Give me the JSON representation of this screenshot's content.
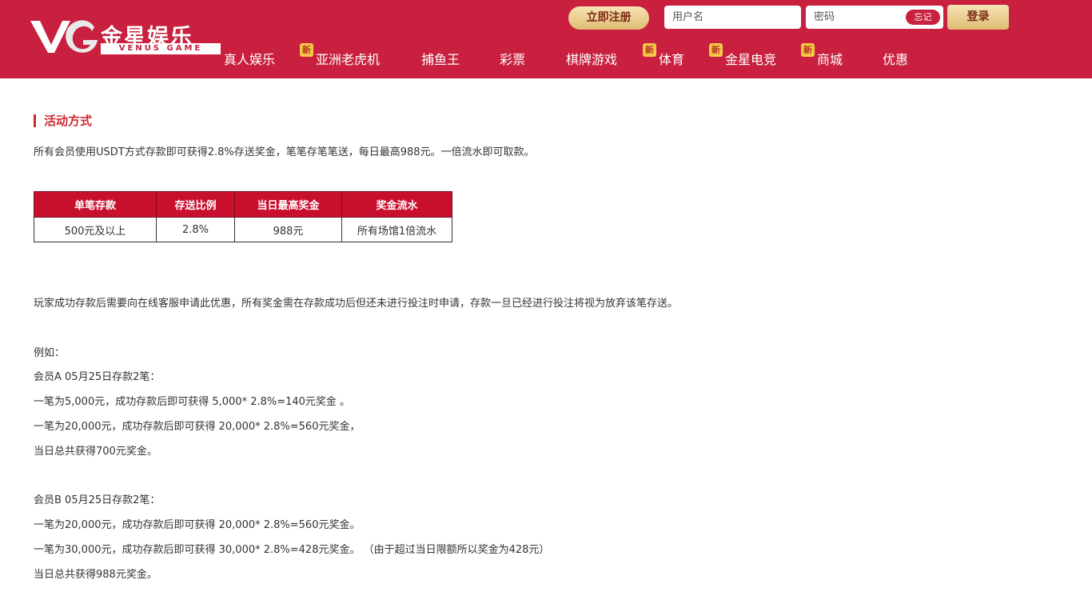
{
  "header": {
    "brand_cn": "金星娱乐",
    "brand_en": "VENUS GAME",
    "register_label": "立即注册",
    "username_placeholder": "用户名",
    "password_placeholder": "密码",
    "forgot_label": "忘记",
    "login_label": "登录"
  },
  "nav": [
    {
      "label": "真人娱乐",
      "badge": ""
    },
    {
      "label": "亚洲老虎机",
      "badge": "新"
    },
    {
      "label": "捕鱼王",
      "badge": ""
    },
    {
      "label": "彩票",
      "badge": ""
    },
    {
      "label": "棋牌游戏",
      "badge": ""
    },
    {
      "label": "体育",
      "badge": "新"
    },
    {
      "label": "金星电竞",
      "badge": "新"
    },
    {
      "label": "商城",
      "badge": "新"
    },
    {
      "label": "优惠",
      "badge": ""
    }
  ],
  "content": {
    "section_title": "活动方式",
    "intro": "所有会员使用USDT方式存款即可获得2.8%存送奖金，笔笔存笔笔送，每日最高988元。一倍流水即可取款。",
    "table": {
      "headers": [
        "单笔存款",
        "存送比例",
        "当日最高奖金",
        "奖金流水"
      ],
      "rows": [
        [
          "500元及以上",
          "2.8%",
          "988元",
          "所有场馆1倍流水"
        ]
      ]
    },
    "notice": "玩家成功存款后需要向在线客服申请此优惠，所有奖金需在存款成功后但还未进行投注时申请，存款一旦已经进行投注将视为放弃该笔存送。",
    "example_lines": [
      "例如：",
      "会员A  05月25日存款2笔：",
      "一笔为5,000元，成功存款后即可获得 5,000* 2.8%=140元奖金 。",
      "一笔为20,000元，成功存款后即可获得 20,000* 2.8%=560元奖金，",
      "当日总共获得700元奖金。",
      "会员B  05月25日存款2笔：",
      "一笔为20,000元，成功存款后即可获得 20,000* 2.8%=560元奖金。",
      "一笔为30,000元，成功存款后即可获得 30,000* 2.8%=428元奖金。 （由于超过当日限额所以奖金为428元）",
      "当日总共获得988元奖金。"
    ]
  },
  "colors": {
    "header_bg": "#c8203e",
    "table_header_bg": "#c8102e",
    "title_red": "#d0282f",
    "gold": "#e0bc74"
  }
}
